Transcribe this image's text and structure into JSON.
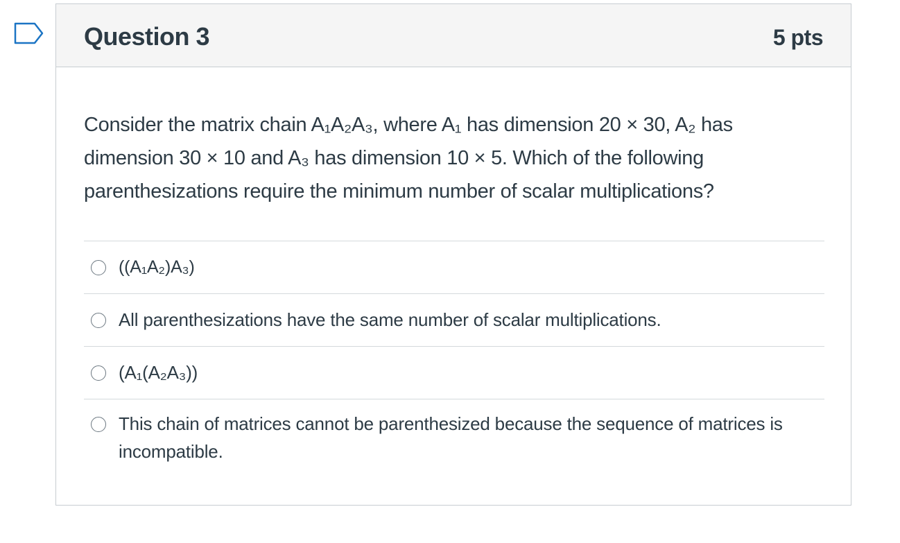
{
  "question": {
    "title": "Question 3",
    "points": "5 pts",
    "text": "Consider the matrix chain A₁A₂A₃, where A₁ has dimension 20 × 30, A₂ has dimension 30 × 10 and A₃ has dimension 10 × 5. Which of the following parenthesizations require the minimum number of scalar multiplications?"
  },
  "answers": [
    {
      "label": "((A₁A₂)A₃)",
      "selected": false
    },
    {
      "label": "All parenthesizations have the same number of scalar multiplications.",
      "selected": false
    },
    {
      "label": "(A₁(A₂A₃))",
      "selected": false
    },
    {
      "label": "This chain of matrices cannot be parenthesized because the sequence of matrices is incompatible.",
      "selected": false
    }
  ],
  "icons": {
    "flag": "bookmark-flag-icon"
  },
  "colors": {
    "flag": "#1b74c4",
    "text": "#2d3b45",
    "header_bg": "#f5f5f5",
    "border": "#c7cdd1"
  }
}
